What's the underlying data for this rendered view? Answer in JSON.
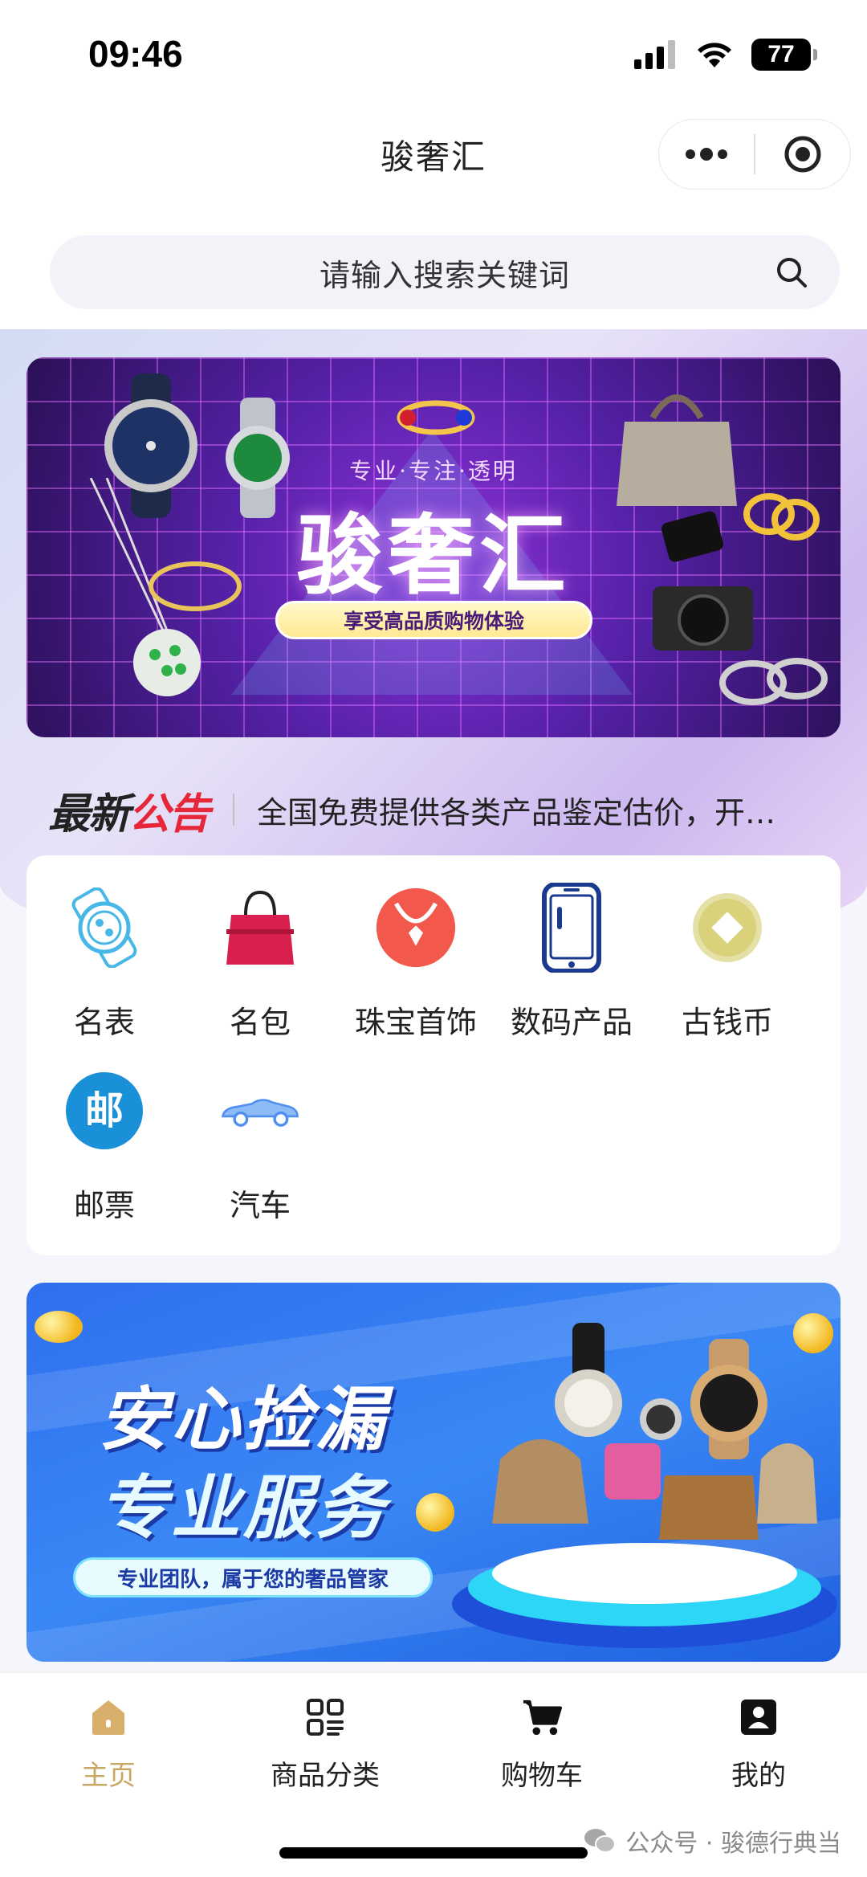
{
  "status_bar": {
    "time": "09:46",
    "battery": "77"
  },
  "header": {
    "title": "骏奢汇"
  },
  "search": {
    "placeholder": "请输入搜索关键词"
  },
  "banner_top": {
    "tagline": "专业·专注·透明",
    "brand": "骏奢汇",
    "slogan": "享受高品质购物体验"
  },
  "notice": {
    "logo_part1": "最新",
    "logo_part2": "公告",
    "text": "全国免费提供各类产品鉴定估价，开…"
  },
  "categories": [
    {
      "label": "名表",
      "icon": "watch-icon",
      "color": "#46b7e6"
    },
    {
      "label": "名包",
      "icon": "handbag-icon",
      "color": "#d81f4d"
    },
    {
      "label": "珠宝首饰",
      "icon": "necklace-icon",
      "color": "#f2584c"
    },
    {
      "label": "数码产品",
      "icon": "phone-icon",
      "color": "#1a3a8f"
    },
    {
      "label": "古钱币",
      "icon": "coin-icon",
      "color": "#d9d27a"
    },
    {
      "label": "邮票",
      "icon": "stamp-icon",
      "color": "#1a90d8"
    },
    {
      "label": "汽车",
      "icon": "car-icon",
      "color": "#4f8ff0"
    }
  ],
  "banner_bottom": {
    "line1": "安心捡漏",
    "line2": "专业服务",
    "slogan": "专业团队，属于您的奢品管家"
  },
  "tabs": [
    {
      "label": "主页",
      "icon": "home-icon",
      "active": true
    },
    {
      "label": "商品分类",
      "icon": "grid-icon",
      "active": false
    },
    {
      "label": "购物车",
      "icon": "cart-icon",
      "active": false
    },
    {
      "label": "我的",
      "icon": "profile-icon",
      "active": false
    }
  ],
  "watermark": {
    "text": "公众号 · 骏德行典当"
  },
  "colors": {
    "accent": "#c9a865",
    "brand_red": "#e8263a"
  }
}
